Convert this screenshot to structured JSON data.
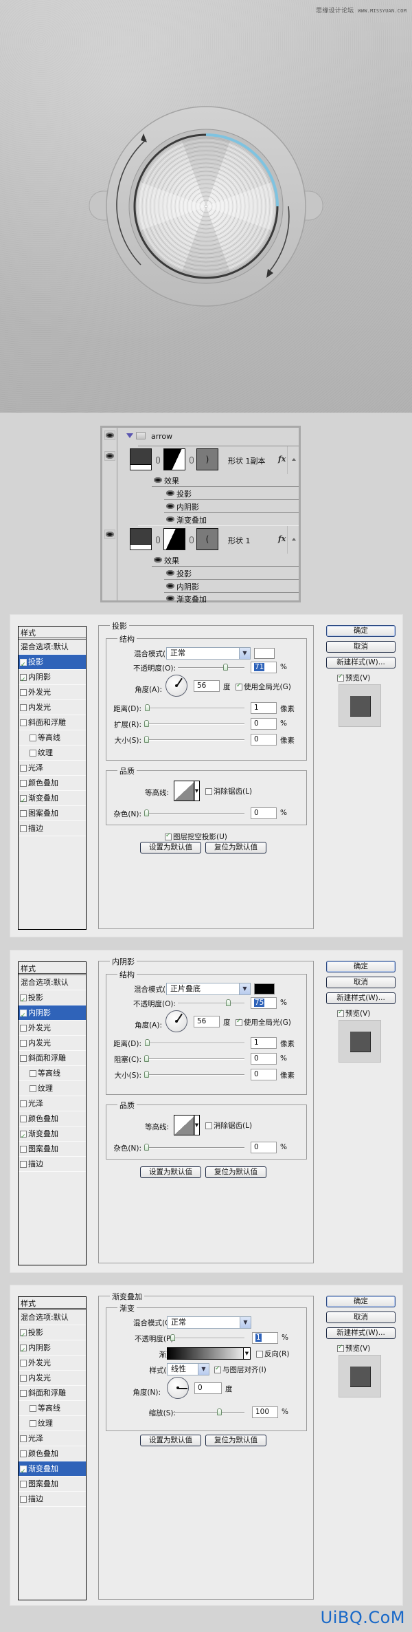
{
  "hero": {
    "watermark_cn": "思缘设计论坛",
    "watermark_url": "WWW.MISSYUAN.COM",
    "knob": {
      "indicator_color": "#7fc3e0",
      "progress_fraction": 0.25
    }
  },
  "layers": {
    "group_name": "arrow",
    "layers": [
      {
        "name": "形状 1副本",
        "vector_glyph": ")",
        "fx": "fx",
        "effects_label": "效果",
        "effects": [
          "投影",
          "内阴影",
          "渐变叠加"
        ]
      },
      {
        "name": "形状 1",
        "vector_glyph": "(",
        "fx": "fx",
        "effects_label": "效果",
        "effects": [
          "投影",
          "内阴影",
          "渐变叠加"
        ]
      }
    ]
  },
  "styles_panel": {
    "header": "样式",
    "blend_options": "混合选项:默认",
    "items": [
      {
        "label": "投影",
        "indent": false
      },
      {
        "label": "内阴影",
        "indent": false
      },
      {
        "label": "外发光",
        "indent": false
      },
      {
        "label": "内发光",
        "indent": false
      },
      {
        "label": "斜面和浮雕",
        "indent": false
      },
      {
        "label": "等高线",
        "indent": true
      },
      {
        "label": "纹理",
        "indent": true
      },
      {
        "label": "光泽",
        "indent": false
      },
      {
        "label": "颜色叠加",
        "indent": false
      },
      {
        "label": "渐变叠加",
        "indent": false
      },
      {
        "label": "图案叠加",
        "indent": false
      },
      {
        "label": "描边",
        "indent": false
      }
    ]
  },
  "buttons": {
    "ok": "确定",
    "cancel": "取消",
    "new_style": "新建样式(W)...",
    "preview": "预览(V)",
    "make_default": "设置为默认值",
    "reset_default": "复位为默认值"
  },
  "dialogs": [
    {
      "title": "投影",
      "selected_index": 0,
      "checked": [
        true,
        true,
        false,
        false,
        false,
        false,
        false,
        false,
        false,
        true,
        false,
        false
      ],
      "structure": "结构",
      "blend_mode_label": "混合模式(B):",
      "blend_mode": "正常",
      "swatch_color": "#ffffff",
      "opacity_label": "不透明度(O):",
      "opacity": "71",
      "opacity_unit": "%",
      "angle_label": "角度(A):",
      "angle": "56",
      "angle_unit": "度",
      "global_light": "使用全局光(G)",
      "global_light_checked": true,
      "distance_label": "距离(D):",
      "distance": "1",
      "distance_unit": "像素",
      "spread_label": "扩展(R):",
      "spread": "0",
      "spread_unit": "%",
      "size_label": "大小(S):",
      "size": "0",
      "size_unit": "像素",
      "quality": "品质",
      "contour_label": "等高线:",
      "antialias": "消除锯齿(L)",
      "noise_label": "杂色(N):",
      "noise": "0",
      "noise_unit": "%",
      "knockout": "图层挖空投影(U)"
    },
    {
      "title": "内阴影",
      "selected_index": 1,
      "checked": [
        true,
        true,
        false,
        false,
        false,
        false,
        false,
        false,
        false,
        true,
        false,
        false
      ],
      "structure": "结构",
      "blend_mode_label": "混合模式(B):",
      "blend_mode": "正片叠底",
      "swatch_color": "#000000",
      "opacity_label": "不透明度(O):",
      "opacity": "75",
      "opacity_unit": "%",
      "angle_label": "角度(A):",
      "angle": "56",
      "angle_unit": "度",
      "global_light": "使用全局光(G)",
      "global_light_checked": true,
      "distance_label": "距离(D):",
      "distance": "1",
      "distance_unit": "像素",
      "choke_label": "阻塞(C):",
      "choke": "0",
      "choke_unit": "%",
      "size_label": "大小(S):",
      "size": "0",
      "size_unit": "像素",
      "quality": "品质",
      "contour_label": "等高线:",
      "antialias": "消除锯齿(L)",
      "noise_label": "杂色(N):",
      "noise": "0",
      "noise_unit": "%"
    },
    {
      "title": "渐变叠加",
      "selected_index": 9,
      "checked": [
        true,
        true,
        false,
        false,
        false,
        false,
        false,
        false,
        false,
        true,
        false,
        false
      ],
      "section": "渐变",
      "blend_mode_label": "混合模式(O):",
      "blend_mode": "正常",
      "opacity_label": "不透明度(P):",
      "opacity": "1",
      "opacity_unit": "%",
      "gradient_label": "渐变:",
      "reverse": "反向(R)",
      "style_label": "样式(L):",
      "style": "线性",
      "align": "与图层对齐(I)",
      "align_checked": true,
      "angle_label": "角度(N):",
      "angle": "0",
      "angle_unit": "度",
      "scale_label": "缩放(S):",
      "scale": "100",
      "scale_unit": "%"
    }
  ],
  "footer_watermark": "UiBQ.CoM"
}
